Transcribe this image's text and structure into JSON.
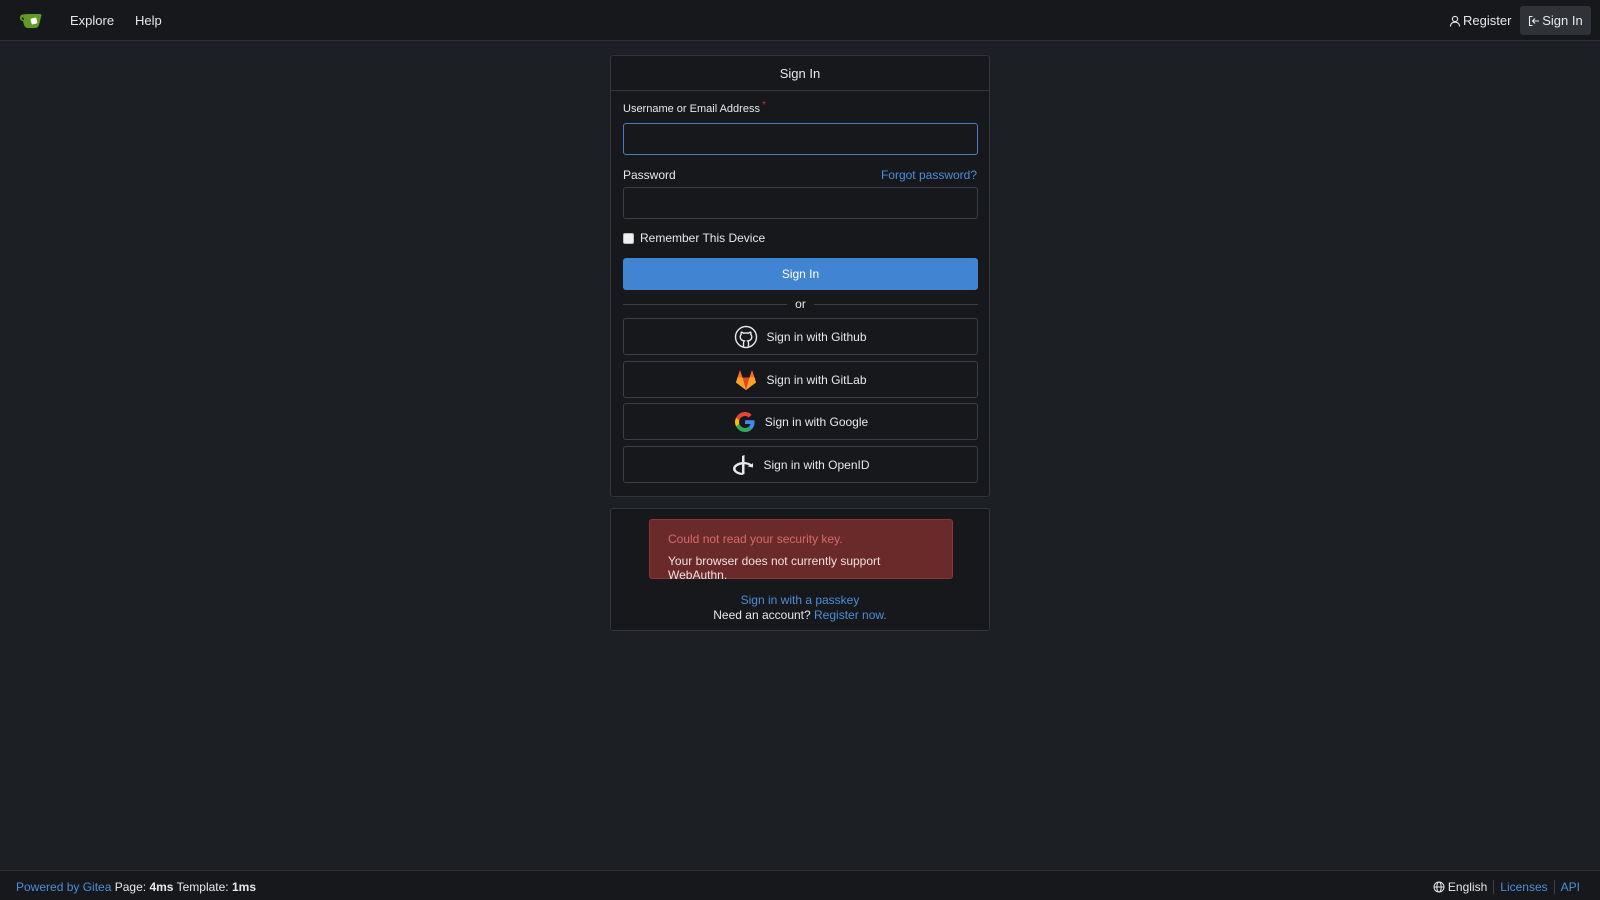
{
  "navbar": {
    "logo_icon": "gitea-teapot-icon",
    "explore": "Explore",
    "help": "Help",
    "register": "Register",
    "sign_in": "Sign In"
  },
  "signin": {
    "title": "Sign In",
    "username_label": "Username or Email Address",
    "required_marker": "*",
    "username_value": "",
    "password_label": "Password",
    "forgot_password": "Forgot password?",
    "password_value": "",
    "remember": "Remember This Device",
    "submit": "Sign In",
    "or": "or",
    "oauth": [
      {
        "label": "Sign in with Github",
        "icon": "github-icon"
      },
      {
        "label": "Sign in with GitLab",
        "icon": "gitlab-icon"
      },
      {
        "label": "Sign in with Google",
        "icon": "google-icon"
      },
      {
        "label": "Sign in with OpenID",
        "icon": "openid-icon"
      }
    ]
  },
  "passkey": {
    "error_title": "Could not read your security key.",
    "error_message": "Your browser does not currently support WebAuthn.",
    "passkey_link": "Sign in with a passkey",
    "need_account": "Need an account?",
    "register_now": "Register now."
  },
  "footer": {
    "powered_by": "Powered by Gitea",
    "page_label": "Page:",
    "page_time": "4ms",
    "template_label": "Template:",
    "template_time": "1ms",
    "language": "English",
    "licenses": "Licenses",
    "api": "API"
  },
  "colors": {
    "background": "#1c1f24",
    "primary": "#4184d2",
    "link": "#4c8ed7",
    "error_bg": "#6b2a2a"
  }
}
